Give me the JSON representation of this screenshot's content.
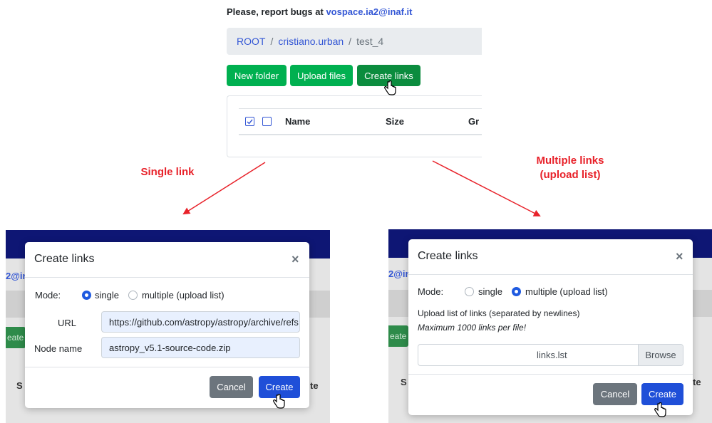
{
  "top": {
    "bug_report_prefix": "Please, report bugs at ",
    "bug_report_email": "vospace.ia2@inaf.it",
    "breadcrumb": {
      "root": "ROOT",
      "user": "cristiano.urban",
      "current": "test_4",
      "separator": "/"
    },
    "toolbar": {
      "new_folder": "New folder",
      "upload_files": "Upload files",
      "create_links": "Create links"
    },
    "table_headers": {
      "name": "Name",
      "size": "Size",
      "group_partial": "Gr"
    }
  },
  "annotations": {
    "single": "Single link",
    "multiple_line1": "Multiple links",
    "multiple_line2": "(upload list)"
  },
  "left_modal": {
    "bg_text_partial": "2@in",
    "bg_button_partial": "eate",
    "bg_head_left": "S",
    "bg_head_right": "te",
    "title": "Create links",
    "close": "×",
    "mode_label": "Mode:",
    "option_single": "single",
    "option_multiple": "multiple (upload list)",
    "url_label": "URL",
    "url_value": "https://github.com/astropy/astropy/archive/refs",
    "node_label": "Node name",
    "node_value": "astropy_v5.1-source-code.zip",
    "cancel": "Cancel",
    "create": "Create"
  },
  "right_modal": {
    "bg_text_partial": "2@in",
    "bg_button_partial": "eate",
    "bg_head_left": "S",
    "bg_head_right": "te",
    "title": "Create links",
    "close": "×",
    "mode_label": "Mode:",
    "option_single": "single",
    "option_multiple": "multiple (upload list)",
    "help_line1": "Upload list of links (separated by newlines)",
    "help_line2": "Maximum 1000 links per file!",
    "file_name": "links.lst",
    "browse": "Browse",
    "cancel": "Cancel",
    "create": "Create"
  },
  "colors": {
    "link_blue": "#3457d5",
    "green": "#00b050",
    "annotation_red": "#e8222a",
    "navbar": "#0e1674",
    "primary": "#1f4fd8",
    "secondary": "#6c757d"
  },
  "icons": {
    "cursor": "hand-pointer-icon",
    "checkbox": "checkbox-icon",
    "radio": "radio-icon",
    "arrow": "red-arrow"
  }
}
